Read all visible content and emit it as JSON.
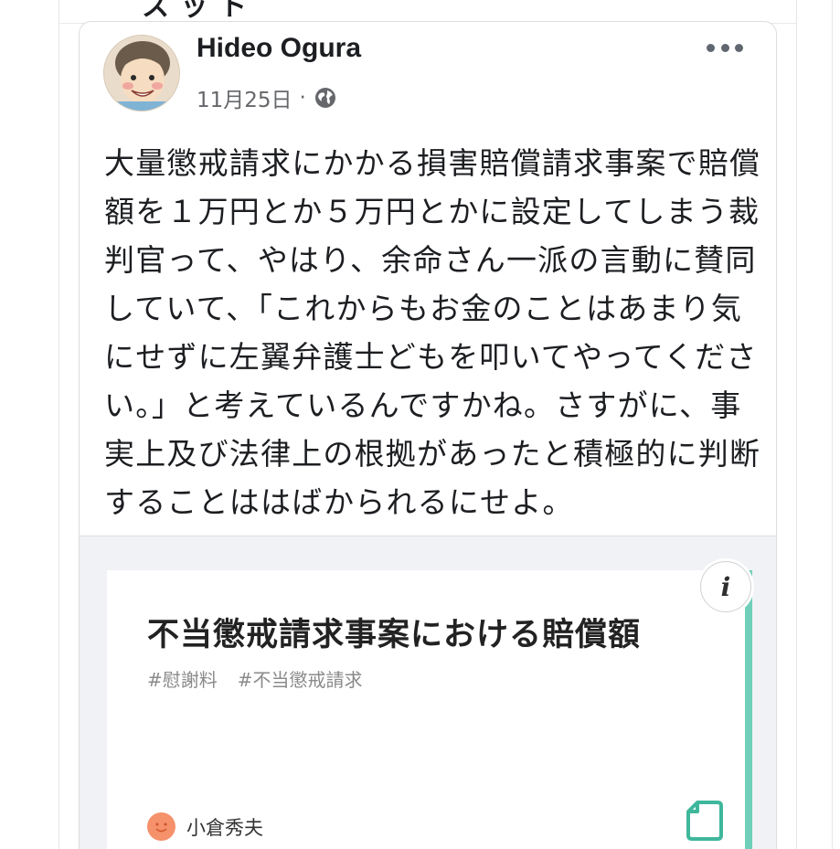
{
  "header": {
    "partial_text": "ス ッ ト"
  },
  "post": {
    "author": "Hideo Ogura",
    "date": "11月25日",
    "meta_separator": "·",
    "text": "大量懲戒請求にかかる損害賠償請求事案で賠償\n額を１万円とか５万円とかに設定してしまう裁\n判官って、やはり、余命さん一派の言動に賛同\nしていて、「これからもお金のことはあまり気\nにせずに左翼弁護士どもを叩いてやってくださ\nい。」と考えているんですかね。さすがに、事\n実上及び法律上の根拠があったと積極的に判断\nすることははばかられるにせよ。"
  },
  "link_preview": {
    "title": "不当懲戒請求事案における賠償額",
    "tags": [
      "#慰謝料",
      "#不当懲戒請求"
    ],
    "author": "小倉秀夫",
    "info_glyph": "i"
  },
  "icons": {
    "avatar": "avatar-icon",
    "globe": "globe-icon",
    "more": "more-options-icon",
    "info": "info-icon",
    "note": "note-document-icon"
  },
  "colors": {
    "accent": "#6fcfb9",
    "text_primary": "#1c1e21",
    "text_secondary": "#65676b"
  }
}
